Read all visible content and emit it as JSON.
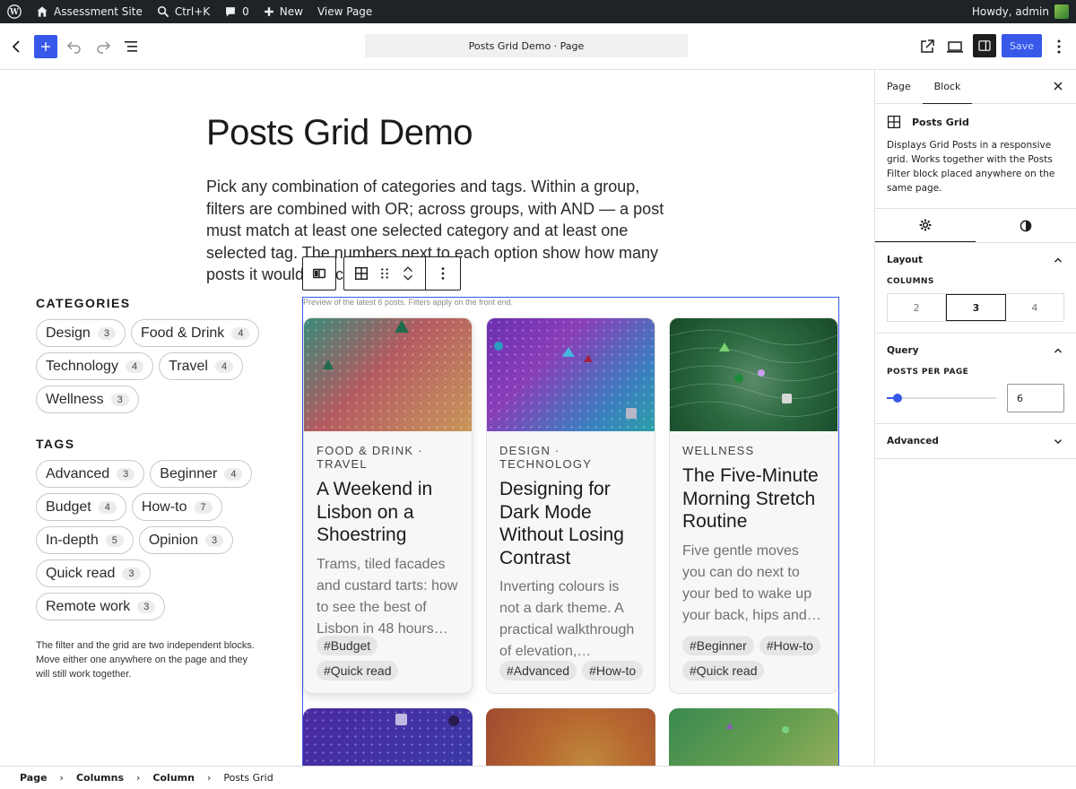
{
  "adminbar": {
    "site_name": "Assessment Site",
    "search_shortcut": "Ctrl+K",
    "comments_count": "0",
    "new_label": "New",
    "view_page_label": "View Page",
    "howdy": "Howdy, admin"
  },
  "header": {
    "document_title": "Posts Grid Demo · Page",
    "save_label": "Save"
  },
  "content": {
    "title": "Posts Grid Demo",
    "intro": "Pick any combination of categories and tags. Within a group, filters are combined with OR; across groups, with AND — a post must match at least one selected category and at least one selected tag. The numbers next to each option show how many posts it would match."
  },
  "filter": {
    "categories_heading": "CATEGORIES",
    "categories": [
      {
        "label": "Design",
        "count": "3"
      },
      {
        "label": "Food & Drink",
        "count": "4"
      },
      {
        "label": "Technology",
        "count": "4"
      },
      {
        "label": "Travel",
        "count": "4"
      },
      {
        "label": "Wellness",
        "count": "3"
      }
    ],
    "tags_heading": "TAGS",
    "tags": [
      {
        "label": "Advanced",
        "count": "3"
      },
      {
        "label": "Beginner",
        "count": "4"
      },
      {
        "label": "Budget",
        "count": "4"
      },
      {
        "label": "How-to",
        "count": "7"
      },
      {
        "label": "In-depth",
        "count": "5"
      },
      {
        "label": "Opinion",
        "count": "3"
      },
      {
        "label": "Quick read",
        "count": "3"
      },
      {
        "label": "Remote work",
        "count": "3"
      }
    ],
    "note": "The filter and the grid are two independent blocks. Move either one anywhere on the page and they will still work together."
  },
  "grid": {
    "note": "Preview of the latest 6 posts. Filters apply on the front end.",
    "posts": [
      {
        "cats": "FOOD & DRINK · TRAVEL",
        "title": "A Weekend in Lisbon on a Shoestring",
        "excerpt": "Trams, tiled facades and custard tarts: how to see the best of Lisbon in 48 hours…",
        "tags": [
          "#Budget",
          "#Quick read"
        ]
      },
      {
        "cats": "DESIGN · TECHNOLOGY",
        "title": "Designing for Dark Mode Without Losing Contrast",
        "excerpt": "Inverting colours is not a dark theme. A practical walkthrough of elevation,…",
        "tags": [
          "#Advanced",
          "#How-to"
        ]
      },
      {
        "cats": "WELLNESS",
        "title": "The Five-Minute Morning Stretch Routine",
        "excerpt": "Five gentle moves you can do next to your bed to wake up your back, hips and…",
        "tags": [
          "#Beginner",
          "#How-to",
          "#Quick read"
        ]
      }
    ]
  },
  "sidebar": {
    "tab_page": "Page",
    "tab_block": "Block",
    "block_name": "Posts Grid",
    "block_desc": "Displays Grid Posts in a responsive grid. Works together with the Posts Filter block placed anywhere on the same page.",
    "layout_label": "Layout",
    "columns_label": "COLUMNS",
    "columns_options": [
      "2",
      "3",
      "4"
    ],
    "columns_selected": "3",
    "query_label": "Query",
    "posts_per_page_label": "POSTS PER PAGE",
    "posts_per_page_value": "6",
    "posts_per_page_fraction": 0.1,
    "advanced_label": "Advanced"
  },
  "breadcrumb": [
    "Page",
    "Columns",
    "Column",
    "Posts Grid"
  ],
  "colors": {
    "accent": "#3858e9",
    "adminbar_bg": "#1d2327"
  }
}
